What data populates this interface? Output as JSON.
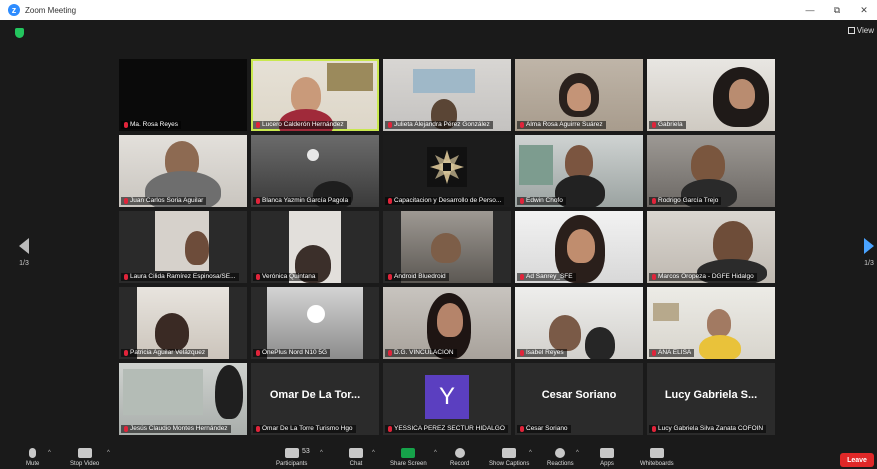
{
  "window": {
    "title": "Zoom Meeting",
    "minimize": "—",
    "maximize": "⧉",
    "close": "✕"
  },
  "view": {
    "label": "View"
  },
  "pager": {
    "left": "1/3",
    "right": "1/3"
  },
  "participants": [
    {
      "name": "Ma. Rosa Reyes"
    },
    {
      "name": "Lucero Calderón Hernández",
      "active": true
    },
    {
      "name": "Julieta Alejandra Pérez González"
    },
    {
      "name": "Alma Rosa Aguirre Suárez"
    },
    {
      "name": "Gabriela"
    },
    {
      "name": "Juan Carlos Soria Aguilar"
    },
    {
      "name": "Blanca Yazmin García Pagola"
    },
    {
      "name": "Capacitacion y Desarrollo de Perso..."
    },
    {
      "name": "Edwin Chofo"
    },
    {
      "name": "Rodrigo García Trejo"
    },
    {
      "name": "Laura Cilida Ramírez Espinosa/SE..."
    },
    {
      "name": "Verónica Quintana"
    },
    {
      "name": "Android Bluedroid"
    },
    {
      "name": "Ad Sanrey_SFE"
    },
    {
      "name": "Marcos Oropeza - DGFE Hidalgo"
    },
    {
      "name": "Patricia Aguilar Velázquez"
    },
    {
      "name": "OnePlus Nord N10 5G"
    },
    {
      "name": "D.G. VINCULACION"
    },
    {
      "name": "Isabel Reyes"
    },
    {
      "name": "ANA ELISA"
    },
    {
      "name": "Jesús Claudio Montes Hernández"
    },
    {
      "name": "Omar De La Torre Turismo Hgo",
      "display": "Omar De La Tor..."
    },
    {
      "name": "YESSICA PEREZ SECTUR HIDALGO",
      "avatar": "Y"
    },
    {
      "name": "Cesar Soriano",
      "display": "Cesar Soriano"
    },
    {
      "name": "Lucy Gabriela  Silva Zanata COFOIN",
      "display": "Lucy Gabriela  S..."
    }
  ],
  "toolbar": {
    "mute": "Mute",
    "stop_video": "Stop Video",
    "participants": "Participants",
    "participant_count": "53",
    "chat": "Chat",
    "share_screen": "Share Screen",
    "record": "Record",
    "show_captions": "Show Captions",
    "reactions": "Reactions",
    "apps": "Apps",
    "whiteboards": "Whiteboards",
    "leave": "Leave"
  },
  "colors": {
    "accent": "#2d8cff",
    "active_speaker": "#c9e84f",
    "leave": "#e02828",
    "share": "#16a34a"
  }
}
